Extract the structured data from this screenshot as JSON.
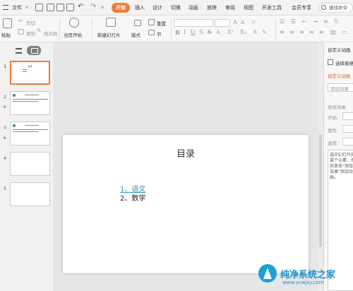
{
  "menubar": {
    "file_label": "文件",
    "tabs": [
      "开始",
      "插入",
      "设计",
      "切换",
      "动画",
      "放映",
      "审阅",
      "视图",
      "开发工具",
      "会员专享"
    ],
    "search_placeholder": "查找命令"
  },
  "ribbon": {
    "paste": "粘贴",
    "cut": "剪切",
    "copy": "复制",
    "format_painter": "格式刷",
    "from_current": "当页开始",
    "new_slide": "新建幻灯片",
    "layout": "版式",
    "section": "节",
    "reset": "重置"
  },
  "thumbnails": [
    {
      "num": "1",
      "title": "目录",
      "active": true
    },
    {
      "num": "2",
      "title": "",
      "active": false
    },
    {
      "num": "3",
      "title": "",
      "active": false
    },
    {
      "num": "4",
      "title": "",
      "active": false
    },
    {
      "num": "5",
      "title": "",
      "active": false
    }
  ],
  "slide": {
    "title": "目录",
    "items": [
      "1、语文",
      "2、数学"
    ]
  },
  "right_panel": {
    "header": "自定义动画",
    "select_pane": "选择窗格",
    "custom_anim": "自定义动画",
    "add_effect": "添加效果",
    "modify": "修改效果",
    "start": "开始:",
    "property": "属性:",
    "speed": "速度:",
    "hint": "选中幻灯片的某个元素，然后单击\"添加效果\"添加动画。"
  },
  "watermark": {
    "text": "纯净系统之家",
    "url": "www.ycwjzy.com"
  },
  "colors": {
    "accent": "#f07b38",
    "link": "#2a9ab5"
  }
}
